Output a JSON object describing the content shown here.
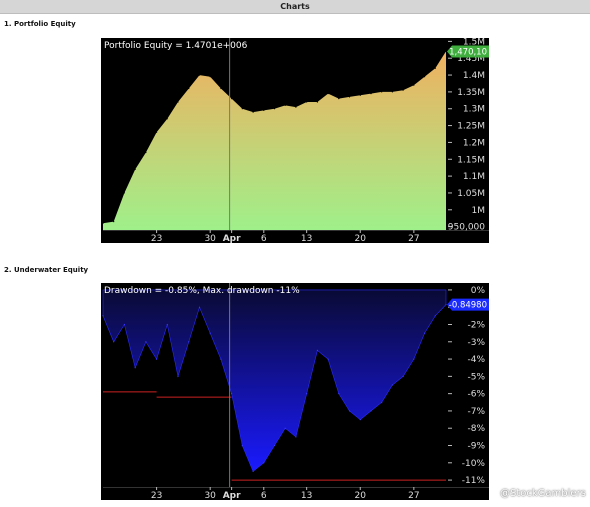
{
  "header": {
    "title": "Charts"
  },
  "sections": [
    {
      "label": "1. Portfolio Equity"
    },
    {
      "label": "2. Underwater Equity"
    }
  ],
  "watermark": "@StockGamblers",
  "chart_data": [
    {
      "type": "area",
      "title": "Portfolio Equity = 1.4701e+006",
      "x_ticks": [
        "23",
        "30",
        "Apr",
        "6",
        "13",
        "20",
        "27"
      ],
      "y_ticks": [
        "950,000",
        "1M",
        "1.05M",
        "1.1M",
        "1.15M",
        "1.2M",
        "1.25M",
        "1.3M",
        "1.35M",
        "1.4M",
        "1.45M",
        "1.5M"
      ],
      "ylim": [
        940000,
        1510000
      ],
      "last_value_label": "1,470,10",
      "colors": {
        "fill_top": "#f0b060",
        "fill_bottom": "#9ff08a",
        "marker": "#3fae3f"
      },
      "x": [
        "Mar 16",
        "Mar 17",
        "Mar 18",
        "Mar 19",
        "Mar 20",
        "Mar 23",
        "Mar 24",
        "Mar 25",
        "Mar 26",
        "Mar 27",
        "Mar 30",
        "Mar 31",
        "Apr 1",
        "Apr 2",
        "Apr 3",
        "Apr 6",
        "Apr 7",
        "Apr 8",
        "Apr 9",
        "Apr 13",
        "Apr 14",
        "Apr 15",
        "Apr 16",
        "Apr 17",
        "Apr 20",
        "Apr 21",
        "Apr 22",
        "Apr 23",
        "Apr 24",
        "Apr 27",
        "Apr 28",
        "Apr 29",
        "Apr 30"
      ],
      "values": [
        960000,
        965000,
        1050000,
        1120000,
        1170000,
        1230000,
        1270000,
        1320000,
        1360000,
        1400000,
        1395000,
        1360000,
        1330000,
        1300000,
        1290000,
        1295000,
        1300000,
        1310000,
        1305000,
        1320000,
        1320000,
        1345000,
        1330000,
        1335000,
        1340000,
        1345000,
        1350000,
        1350000,
        1355000,
        1370000,
        1395000,
        1420000,
        1470100
      ]
    },
    {
      "type": "area",
      "title": "Drawdown = -0.85%, Max. drawdown -11%",
      "x_ticks": [
        "23",
        "30",
        "Apr",
        "6",
        "13",
        "20",
        "27"
      ],
      "y_ticks": [
        "0%",
        "-1%",
        "-2%",
        "-3%",
        "-4%",
        "-5%",
        "-6%",
        "-7%",
        "-8%",
        "-9%",
        "-10%",
        "-11%"
      ],
      "ylim": [
        -11.4,
        0.4
      ],
      "last_value_label": "-0.84980",
      "colors": {
        "fill_top": "#0a0a35",
        "fill_bottom": "#1a1aff",
        "marker": "#1a2bff",
        "max_dd_line": "#cc2222"
      },
      "x": [
        "Mar 16",
        "Mar 17",
        "Mar 18",
        "Mar 19",
        "Mar 20",
        "Mar 23",
        "Mar 24",
        "Mar 25",
        "Mar 26",
        "Mar 27",
        "Mar 30",
        "Mar 31",
        "Apr 1",
        "Apr 2",
        "Apr 3",
        "Apr 6",
        "Apr 7",
        "Apr 8",
        "Apr 9",
        "Apr 13",
        "Apr 14",
        "Apr 15",
        "Apr 16",
        "Apr 17",
        "Apr 20",
        "Apr 21",
        "Apr 22",
        "Apr 23",
        "Apr 24",
        "Apr 27",
        "Apr 28",
        "Apr 29",
        "Apr 30"
      ],
      "values": [
        -1.5,
        -3.0,
        -2.0,
        -4.5,
        -3.0,
        -4.0,
        -2.0,
        -5.0,
        -3.0,
        -1.0,
        -2.5,
        -4.0,
        -6.0,
        -9.0,
        -10.5,
        -10.0,
        -9.0,
        -8.0,
        -8.5,
        -6.0,
        -3.5,
        -4.0,
        -6.0,
        -7.0,
        -7.5,
        -7.0,
        -6.5,
        -5.5,
        -5.0,
        -4.0,
        -2.5,
        -1.5,
        -0.85
      ],
      "max_drawdown_steps": [
        {
          "from": "Mar 16",
          "to": "Mar 23",
          "level": -5.9
        },
        {
          "from": "Mar 23",
          "to": "Apr 1",
          "level": -6.2
        },
        {
          "from": "Apr 1",
          "to": "Apr 30",
          "level": -11.0
        }
      ]
    }
  ]
}
